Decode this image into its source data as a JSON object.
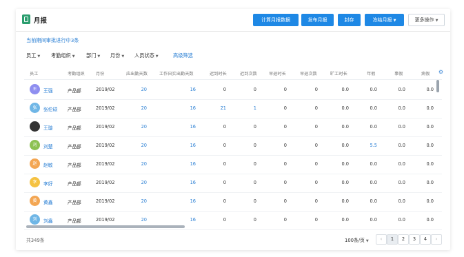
{
  "header": {
    "title": "月报",
    "buttons": {
      "calc": "计算月报数据",
      "publish": "发布月报",
      "archive": "封存",
      "freeze": "冻结月报",
      "more": "更多操作"
    }
  },
  "notice": "当前期间审批进行中3条",
  "filters": {
    "employee": "员工",
    "org": "考勤组织",
    "dept": "部门",
    "month": "月份",
    "status": "人员状态",
    "advanced": "高级筛选"
  },
  "columns": [
    "员工",
    "考勤组织",
    "月份",
    "应出勤天数",
    "工作日实出勤天数",
    "迟到时长",
    "迟到次数",
    "早退时长",
    "早退次数",
    "旷工时长",
    "年假",
    "事假",
    "病假"
  ],
  "rows": [
    {
      "name": "王强",
      "initial": "王",
      "avatar_color": "#8e8ef0",
      "org": "产品部",
      "month": "2019/02",
      "due": "20",
      "actual": "16",
      "late_len": "0",
      "late_cnt": "0",
      "early_len": "0",
      "early_cnt": "0",
      "absent": "0.0",
      "annual": "0.0",
      "personal": "0.0",
      "sick": "0.0"
    },
    {
      "name": "张伦硕",
      "initial": "张",
      "avatar_color": "#6fb6e6",
      "org": "产品部",
      "month": "2019/02",
      "due": "20",
      "actual": "16",
      "late_len": "21",
      "late_cnt": "1",
      "early_len": "0",
      "early_cnt": "0",
      "absent": "0.0",
      "annual": "0.0",
      "personal": "0.0",
      "sick": "0.0"
    },
    {
      "name": "王璇",
      "initial": "",
      "avatar_color": "#333333",
      "org": "产品部",
      "month": "2019/02",
      "due": "20",
      "actual": "16",
      "late_len": "0",
      "late_cnt": "0",
      "early_len": "0",
      "early_cnt": "0",
      "absent": "0.0",
      "annual": "0.0",
      "personal": "0.0",
      "sick": "0.0"
    },
    {
      "name": "刘楚",
      "initial": "刘",
      "avatar_color": "#8cc152",
      "org": "产品部",
      "month": "2019/02",
      "due": "20",
      "actual": "16",
      "late_len": "0",
      "late_cnt": "0",
      "early_len": "0",
      "early_cnt": "0",
      "absent": "0.0",
      "annual": "5.5",
      "personal": "0.0",
      "sick": "0.0"
    },
    {
      "name": "赵敏",
      "initial": "赵",
      "avatar_color": "#f3a653",
      "org": "产品部",
      "month": "2019/02",
      "due": "20",
      "actual": "16",
      "late_len": "0",
      "late_cnt": "0",
      "early_len": "0",
      "early_cnt": "0",
      "absent": "0.0",
      "annual": "0.0",
      "personal": "0.0",
      "sick": "0.0"
    },
    {
      "name": "李好",
      "initial": "李",
      "avatar_color": "#f5c242",
      "org": "产品部",
      "month": "2019/02",
      "due": "20",
      "actual": "16",
      "late_len": "0",
      "late_cnt": "0",
      "early_len": "0",
      "early_cnt": "0",
      "absent": "0.0",
      "annual": "0.0",
      "personal": "0.0",
      "sick": "0.0"
    },
    {
      "name": "黄鑫",
      "initial": "黄",
      "avatar_color": "#f3a653",
      "org": "产品部",
      "month": "2019/02",
      "due": "20",
      "actual": "16",
      "late_len": "0",
      "late_cnt": "0",
      "early_len": "0",
      "early_cnt": "0",
      "absent": "0.0",
      "annual": "0.0",
      "personal": "0.0",
      "sick": "0.0"
    },
    {
      "name": "刘鑫",
      "initial": "刘",
      "avatar_color": "#6fb6e6",
      "org": "产品部",
      "month": "2019/02",
      "due": "20",
      "actual": "16",
      "late_len": "0",
      "late_cnt": "0",
      "early_len": "0",
      "early_cnt": "0",
      "absent": "0.0",
      "annual": "0.0",
      "personal": "0.0",
      "sick": "0.0"
    }
  ],
  "footer": {
    "total": "共349条",
    "per_page": "100条/页",
    "pages": [
      "1",
      "2",
      "3",
      "4"
    ],
    "active_page": "1"
  },
  "colors": {
    "primary": "#1e88e5",
    "link": "#2a7fd4",
    "logo": "#2a9d6e"
  }
}
